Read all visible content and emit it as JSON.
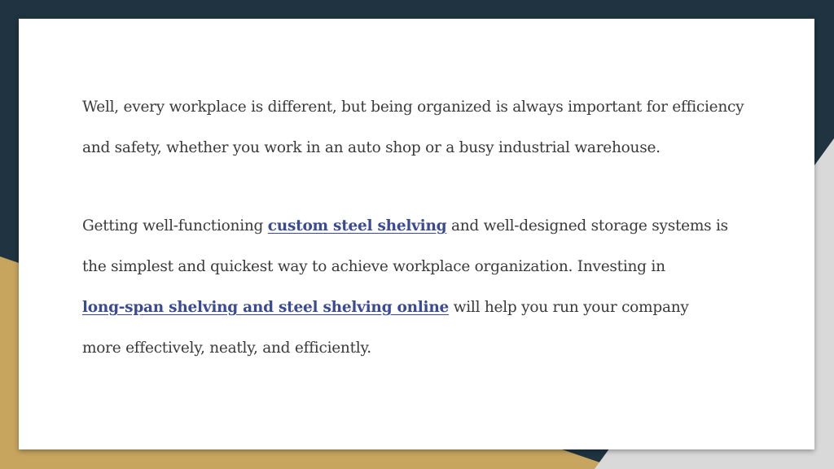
{
  "colors": {
    "background_dark": "#1f3440",
    "background_gold": "#c7a55f",
    "background_light": "#d9d9d9",
    "card": "#ffffff",
    "text": "#3a3a3a",
    "link": "#3b4a95"
  },
  "paragraph1": {
    "line1": "Well, every workplace is different, but being organized is always important for efficiency",
    "line2": "and safety, whether you work in an auto shop or a busy industrial warehouse."
  },
  "paragraph2": {
    "prefix": "Getting well-functioning ",
    "link1": "custom steel shelving",
    "suffix1": " and well-designed storage systems is",
    "line2": "the simplest and quickest way to achieve workplace organization. Investing in",
    "link2": "long-span shelving and steel shelving online",
    "suffix2": " will help you run your company",
    "line4": "more effectively, neatly, and efficiently."
  }
}
